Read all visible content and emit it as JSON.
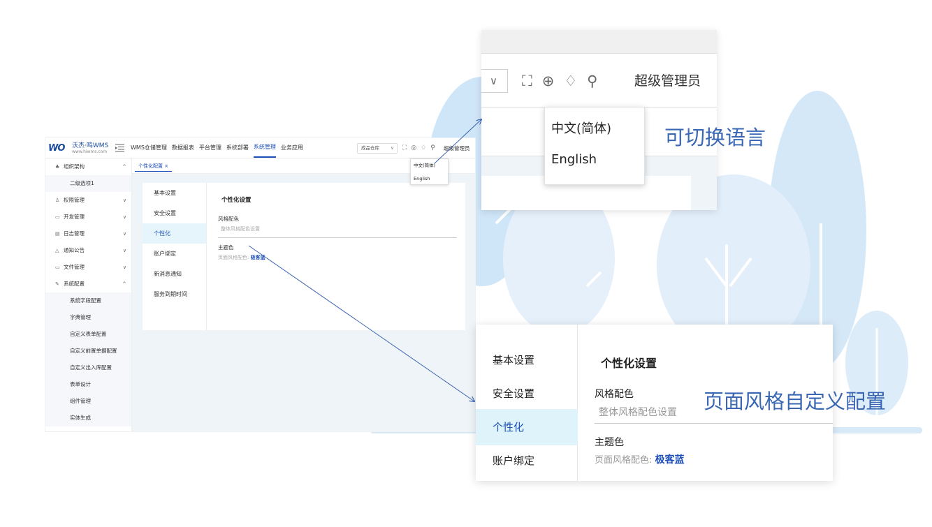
{
  "app": {
    "logo_mark": "WO",
    "logo_name": "沃杰·鸣WMS",
    "logo_url": "www.hiwms.com",
    "nav": [
      "WMS仓储管理",
      "数据报表",
      "平台管理",
      "系统部署",
      "系统管理",
      "业务应用"
    ],
    "nav_active_index": 4,
    "warehouse_select": "成品仓库",
    "user": "超级管理员",
    "language_options": [
      "中文(简体)",
      "English"
    ],
    "sidebar": {
      "group1": "组织架构",
      "group1_sub": "二级选项1",
      "items": [
        "权限管理",
        "开发管理",
        "日志管理",
        "通知公告",
        "文件管理"
      ],
      "group2": "系统配置",
      "group2_subs": [
        "系统字段配置",
        "字典管理",
        "自定义表单配置",
        "自定义前置单据配置",
        "自定义出入库配置",
        "表单设计",
        "组件管理",
        "实体生成"
      ]
    },
    "tab": "个性化配置",
    "settings_menu": [
      "基本设置",
      "安全设置",
      "个性化",
      "账户绑定",
      "新消息通知",
      "服务到期时间"
    ],
    "settings_active_index": 2,
    "panel": {
      "title": "个性化设置",
      "style_label": "风格配色",
      "style_hint": "整体风格配色设置",
      "theme_label": "主题色",
      "theme_prefix": "页面风格配色:",
      "theme_value": "极客蓝"
    }
  },
  "zoom_language": {
    "select_caret": "∨",
    "user": "超级管理员",
    "options": [
      "中文(简体)",
      "English"
    ]
  },
  "zoom_personal": {
    "menu": [
      "基本设置",
      "安全设置",
      "个性化",
      "账户绑定"
    ],
    "active_index": 2,
    "title": "个性化设置",
    "style_label": "风格配色",
    "style_hint": "整体风格配色设置",
    "theme_label": "主题色",
    "theme_prefix": "页面风格配色:",
    "theme_value": "极客蓝"
  },
  "captions": {
    "language": "可切换语言",
    "personal": "页面风格自定义配置"
  },
  "colors": {
    "accent": "#1d4fb8",
    "caption": "#3a67b4",
    "active_bg": "#e6f5fb",
    "tree_light": "#dcecf9",
    "tree_mid": "#b9d8f4"
  }
}
